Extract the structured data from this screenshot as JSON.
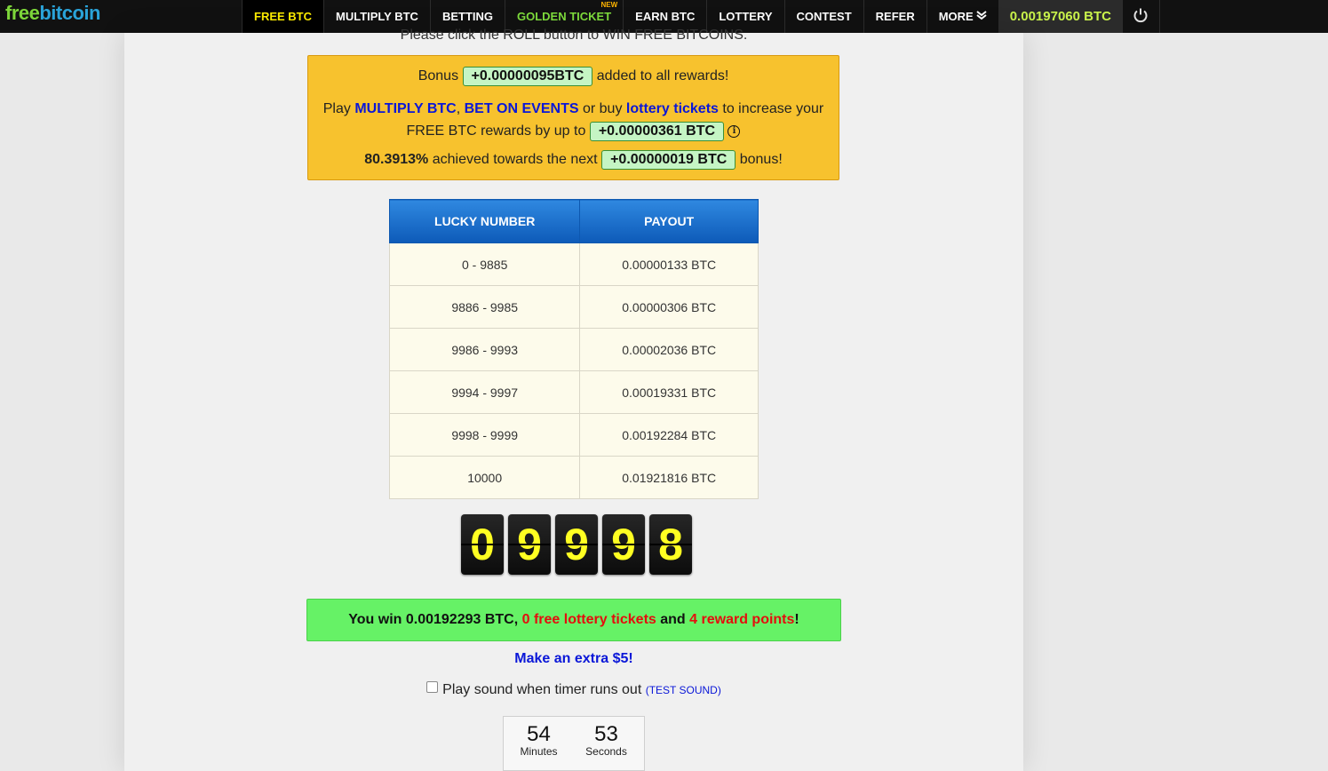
{
  "logo": {
    "part1": "free",
    "part2": "bitcoin"
  },
  "nav": {
    "items": [
      {
        "label": "FREE BTC"
      },
      {
        "label": "MULTIPLY BTC"
      },
      {
        "label": "BETTING"
      },
      {
        "label": "GOLDEN TICKET",
        "badge": "NEW"
      },
      {
        "label": "EARN BTC"
      },
      {
        "label": "LOTTERY"
      },
      {
        "label": "CONTEST"
      },
      {
        "label": "REFER"
      },
      {
        "label": "MORE"
      }
    ],
    "balance": "0.00197060 BTC",
    "power_icon": "power-icon"
  },
  "main": {
    "click_text": "Please click the ROLL button to WIN FREE BITCOINS.",
    "bonus": {
      "prefix": "Bonus",
      "bonus_amount": "+0.00000095BTC",
      "suffix": "added to all rewards!",
      "play_text": "Play",
      "multiply_link": "MULTIPLY BTC",
      "comma": ",",
      "bet_link": "BET ON EVENTS",
      "or_buy": "or buy",
      "lottery_link": "lottery tickets",
      "increase_text": "to increase your",
      "free_btc_text": "FREE BTC rewards by up to",
      "max_amount": "+0.00000361 BTC",
      "info_icon": "i",
      "achieved_pct": "80.3913%",
      "achieved_text": "achieved towards the next",
      "next_amount": "+0.00000019 BTC",
      "bonus_word": "bonus!"
    },
    "payout_table": {
      "headers": [
        "LUCKY NUMBER",
        "PAYOUT"
      ],
      "rows": [
        [
          "0 - 9885",
          "0.00000133 BTC"
        ],
        [
          "9886 - 9985",
          "0.00000306 BTC"
        ],
        [
          "9986 - 9993",
          "0.00002036 BTC"
        ],
        [
          "9994 - 9997",
          "0.00019331 BTC"
        ],
        [
          "9998 - 9999",
          "0.00192284 BTC"
        ],
        [
          "10000",
          "0.01921816 BTC"
        ]
      ]
    },
    "roll_digits": [
      "0",
      "9",
      "9",
      "9",
      "8"
    ],
    "win": {
      "prefix": "You win 0.00192293 BTC,",
      "tickets": "0 free lottery tickets",
      "and": "and",
      "points": "4 reward points",
      "end": "!"
    },
    "extra_link": "Make an extra $5!",
    "sound": {
      "label": "Play sound when timer runs out",
      "test": "(TEST SOUND)",
      "checked": false
    },
    "timer": {
      "minutes": "54",
      "minutes_label": "Minutes",
      "seconds": "53",
      "seconds_label": "Seconds"
    }
  },
  "colors": {
    "nav_bg": "#111111",
    "active_tab": "#ffee00",
    "golden_ticket": "#7edc3c",
    "balance": "#c9f24b",
    "bonus_box": "#f7c22e",
    "pill": "#c5f5c4",
    "table_header": "#1a6fcc",
    "table_cell": "#fdfbeb",
    "digit_text": "#ffff22",
    "win_box": "#66f266",
    "link": "#0a17d8",
    "highlight_red": "#e40e0e"
  }
}
